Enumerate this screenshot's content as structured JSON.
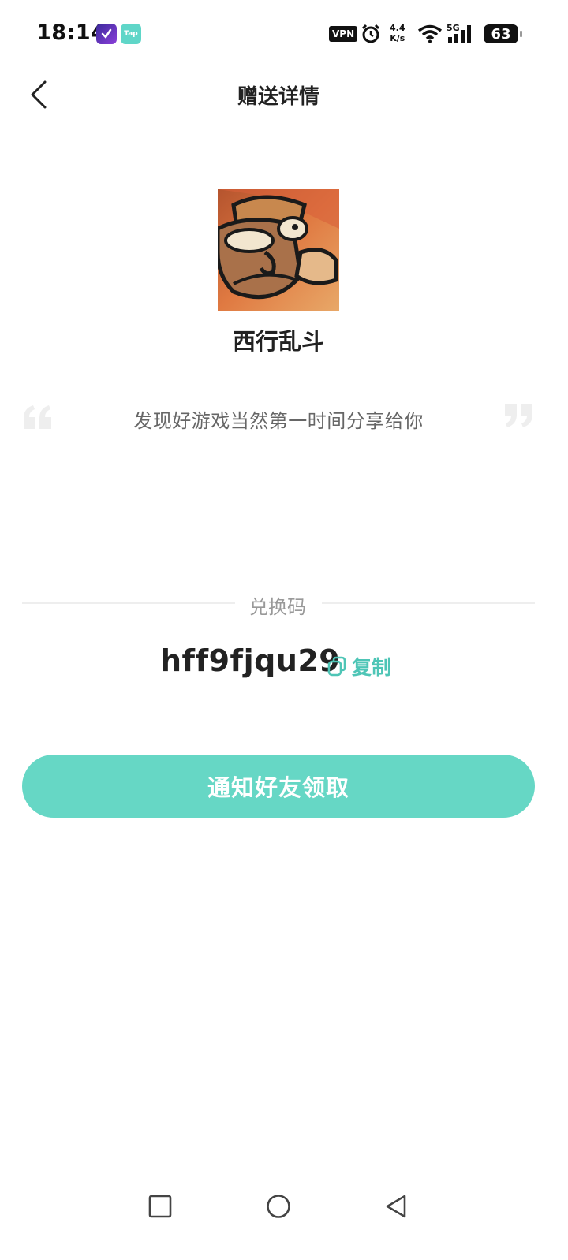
{
  "status_bar": {
    "time": "18:14",
    "app1_label": "",
    "app2_label": "Tap",
    "vpn": "VPN",
    "net_speed_value": "4.4",
    "net_speed_unit": "K/s",
    "network_type": "5G",
    "battery": "63"
  },
  "header": {
    "title": "赠送详情",
    "back_icon": "chevron-left-icon"
  },
  "game": {
    "name": "西行乱斗"
  },
  "quote": {
    "text": "发现好游戏当然第一时间分享给你"
  },
  "redeem": {
    "label": "兑换码",
    "code": "hff9fjqu29",
    "copy_label": "复制"
  },
  "actions": {
    "notify_label": "通知好友领取"
  },
  "nav": {
    "recent_icon": "square-icon",
    "home_icon": "circle-icon",
    "back_icon": "triangle-back-icon"
  },
  "colors": {
    "accent": "#66d7c5",
    "copy": "#4ec5b6",
    "quote_mark": "#eeeeee"
  }
}
